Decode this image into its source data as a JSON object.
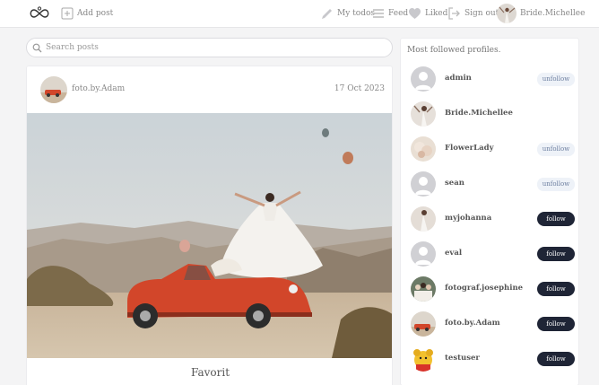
{
  "nav": {
    "add_post": "Add post",
    "my_todos": "My todos",
    "feed": "Feed",
    "liked": "Liked",
    "sign_out": "Sign out",
    "username": "Bride.Michellee"
  },
  "search": {
    "placeholder": "Search posts"
  },
  "post": {
    "username": "foto.by.Adam",
    "date": "17 Oct 2023",
    "caption": "Favorit"
  },
  "sidebar": {
    "title": "Most followed profiles.",
    "profiles": [
      {
        "name": "admin",
        "action": "unfollow",
        "avatar": "default"
      },
      {
        "name": "Bride.Michellee",
        "action": "",
        "avatar": "bride"
      },
      {
        "name": "FlowerLady",
        "action": "unfollow",
        "avatar": "flowers"
      },
      {
        "name": "sean",
        "action": "unfollow",
        "avatar": "default"
      },
      {
        "name": "myjohanna",
        "action": "follow",
        "avatar": "bride"
      },
      {
        "name": "eval",
        "action": "follow",
        "avatar": "default"
      },
      {
        "name": "fotograf.josephine",
        "action": "follow",
        "avatar": "group"
      },
      {
        "name": "foto.by.Adam",
        "action": "follow",
        "avatar": "car"
      },
      {
        "name": "testuser",
        "action": "follow",
        "avatar": "pooh"
      }
    ]
  },
  "colors": {
    "accent_dark": "#1f2536",
    "unfollow_bg": "#eef2f8",
    "car_red": "#d2462a"
  }
}
